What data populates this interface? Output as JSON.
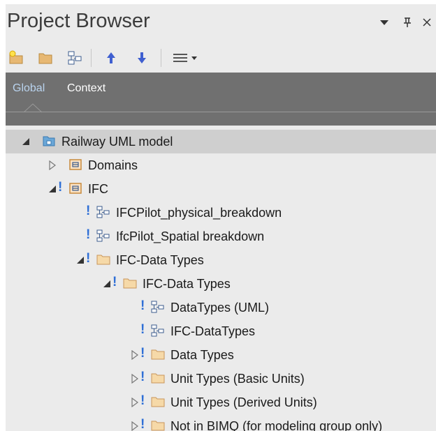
{
  "panel": {
    "title": "Project Browser",
    "controls": [
      "dropdown-arrow-icon",
      "pin-icon",
      "close-icon"
    ]
  },
  "toolbar": {
    "buttons": [
      "new-model-icon",
      "new-package-icon",
      "new-diagram-icon",
      "move-up-icon",
      "move-down-icon",
      "menu-icon"
    ]
  },
  "tabs": [
    {
      "label": "Global",
      "active": true
    },
    {
      "label": "Context",
      "active": false
    }
  ],
  "colors": {
    "panel_bg": "#ebebeb",
    "tab_bar": "#707070",
    "active_tab": "#b9d3ee",
    "selected_row": "#cfcfcf",
    "folder": "#e7b873",
    "marker": "#2f6fd6"
  },
  "tree": [
    {
      "label": "Railway UML model",
      "level": 0,
      "icon": "model-root-icon",
      "expanded": true,
      "marker": false,
      "selected": true
    },
    {
      "label": "Domains",
      "level": 1,
      "icon": "package-icon",
      "expanded": false,
      "marker": false
    },
    {
      "label": "IFC",
      "level": 1,
      "icon": "package-icon",
      "expanded": true,
      "marker": true
    },
    {
      "label": "IFCPilot_physical_breakdown",
      "level": 2,
      "icon": "diagram-icon",
      "leaf": true,
      "marker": true
    },
    {
      "label": "IfcPilot_Spatial breakdown",
      "level": 2,
      "icon": "diagram-icon",
      "leaf": true,
      "marker": true
    },
    {
      "label": "IFC-Data Types",
      "level": 2,
      "icon": "folder-icon",
      "expanded": true,
      "marker": true
    },
    {
      "label": "IFC-Data Types",
      "level": 3,
      "icon": "folder-icon",
      "expanded": true,
      "marker": true
    },
    {
      "label": "DataTypes (UML)",
      "level": 4,
      "icon": "diagram-icon",
      "leaf": true,
      "marker": true
    },
    {
      "label": "IFC-DataTypes",
      "level": 4,
      "icon": "diagram-icon",
      "leaf": true,
      "marker": true
    },
    {
      "label": "Data Types",
      "level": 4,
      "icon": "folder-icon",
      "expanded": false,
      "marker": true
    },
    {
      "label": "Unit Types (Basic Units)",
      "level": 4,
      "icon": "folder-icon",
      "expanded": false,
      "marker": true
    },
    {
      "label": "Unit Types (Derived Units)",
      "level": 4,
      "icon": "folder-icon",
      "expanded": false,
      "marker": true
    },
    {
      "label": "Not in BIMQ (for modeling group only)",
      "level": 4,
      "icon": "folder-icon",
      "expanded": false,
      "marker": true
    }
  ]
}
